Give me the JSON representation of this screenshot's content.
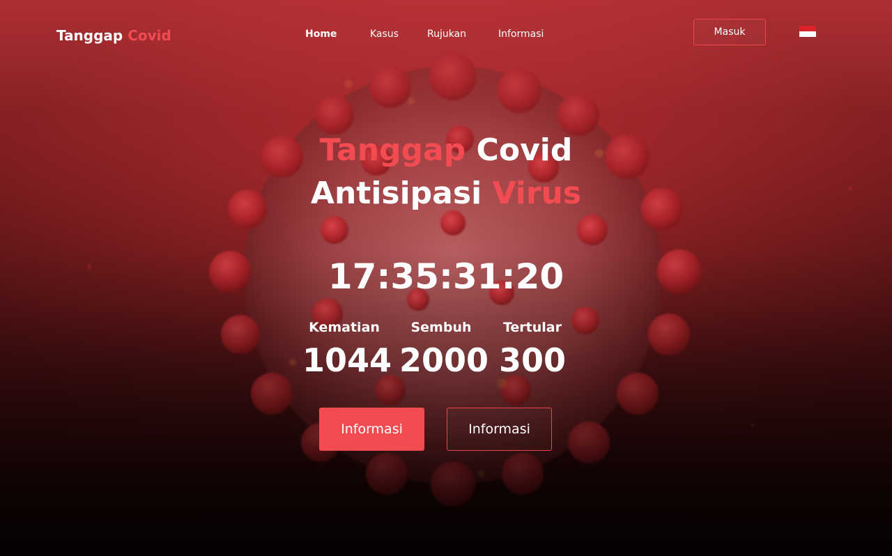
{
  "brand": {
    "name": "Tanggap",
    "accent": "Covid"
  },
  "nav": {
    "items": [
      {
        "label": "Home"
      },
      {
        "label": "Kasus"
      },
      {
        "label": "Rujukan"
      },
      {
        "label": "Informasi"
      }
    ],
    "login_label": "Masuk",
    "language_icon": "indonesia-flag-icon"
  },
  "hero": {
    "line1_accent": "Tanggap",
    "line1_rest": "Covid",
    "line2_start": "Antisipasi",
    "line2_accent": "Virus",
    "timer": "17:35:31:20"
  },
  "stats": [
    {
      "label": "Kematian",
      "value": "1044"
    },
    {
      "label": "Sembuh",
      "value": "2000"
    },
    {
      "label": "Tertular",
      "value": "300"
    }
  ],
  "actions": {
    "primary_label": "Informasi",
    "secondary_label": "Informasi"
  },
  "colors": {
    "accent": "#f24b51",
    "background_top": "#c4363a",
    "background_bottom": "#060202",
    "text": "#ffffff"
  }
}
